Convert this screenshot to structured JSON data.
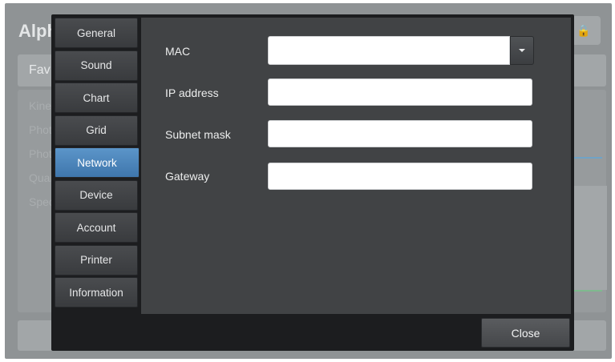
{
  "background": {
    "title": "Alph",
    "favorites_label": "Fav",
    "list_items": [
      "Kinet",
      "Photo",
      "Photo",
      "Quan",
      "Spec"
    ]
  },
  "dialog": {
    "tabs": [
      {
        "label": "General",
        "active": false
      },
      {
        "label": "Sound",
        "active": false
      },
      {
        "label": "Chart",
        "active": false
      },
      {
        "label": "Grid",
        "active": false
      },
      {
        "label": "Network",
        "active": true
      },
      {
        "label": "Device",
        "active": false
      },
      {
        "label": "Account",
        "active": false
      },
      {
        "label": "Printer",
        "active": false
      },
      {
        "label": "Information",
        "active": false
      }
    ],
    "fields": {
      "mac_label": "MAC",
      "mac_value": "",
      "ip_label": "IP address",
      "ip_value": "",
      "subnet_label": "Subnet mask",
      "subnet_value": "",
      "gateway_label": "Gateway",
      "gateway_value": ""
    },
    "close_label": "Close"
  },
  "colors": {
    "accent": "#4a86be",
    "dialog_bg": "#1c1d1f",
    "content_bg": "#414345"
  }
}
